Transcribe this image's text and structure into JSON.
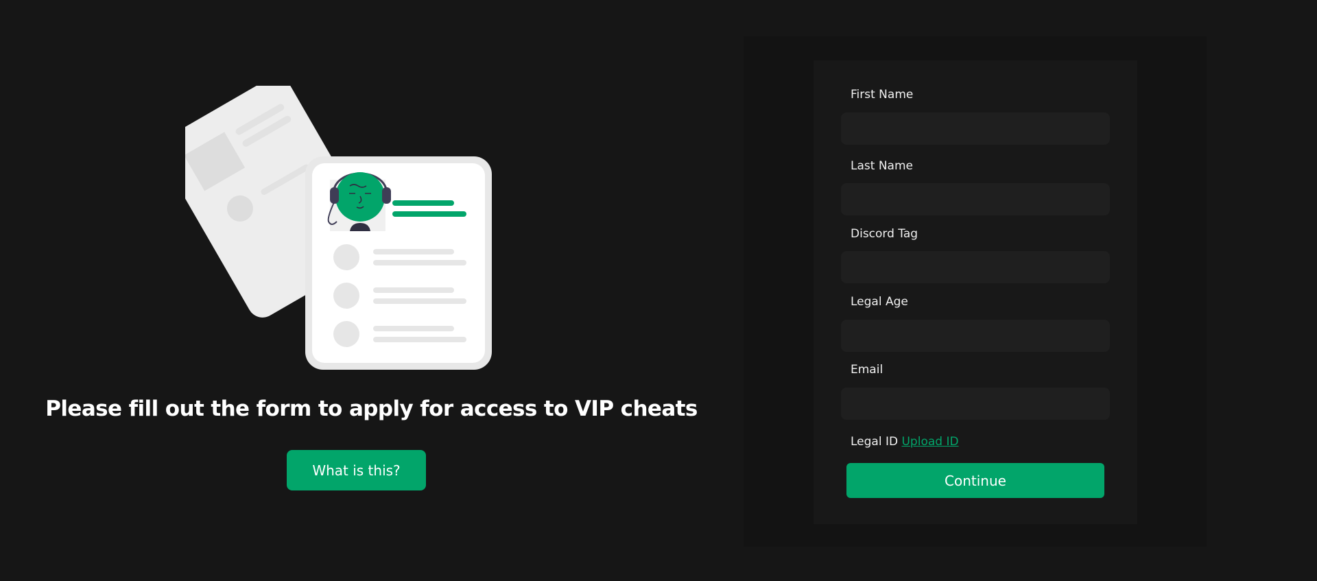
{
  "hero": {
    "headline": "Please fill out the form to apply for access to VIP cheats",
    "info_button_label": "What is this?",
    "illustration_icon": "profile-documents-icon"
  },
  "form": {
    "fields": [
      {
        "label": "First Name",
        "value": "",
        "placeholder": ""
      },
      {
        "label": "Last Name",
        "value": "",
        "placeholder": ""
      },
      {
        "label": "Discord Tag",
        "value": "",
        "placeholder": ""
      },
      {
        "label": "Legal Age",
        "value": "",
        "placeholder": ""
      },
      {
        "label": "Email",
        "value": "",
        "placeholder": ""
      }
    ],
    "legal_id_label": "Legal ID",
    "upload_link_label": "Upload ID",
    "submit_label": "Continue"
  },
  "colors": {
    "background": "#161616",
    "accent": "#02a56a",
    "panel": "#181818",
    "input": "#1f1f1f"
  }
}
